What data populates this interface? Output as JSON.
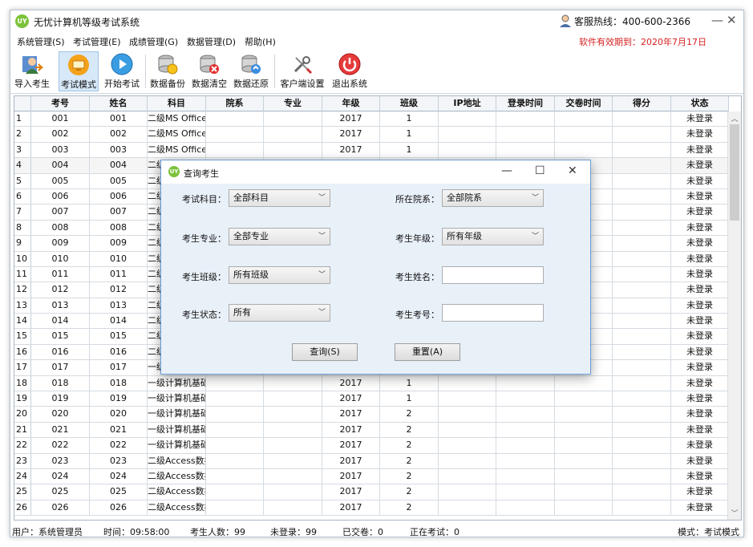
{
  "app": {
    "title": "无忧计算机等级考试系统",
    "logo": "UY",
    "hotline": "客服热线：400-600-2366",
    "expire": "软件有效期到：2020年7月17日"
  },
  "menu": [
    "系统管理(S)",
    "考试管理(E)",
    "成绩管理(G)",
    "数据管理(D)",
    "帮助(H)"
  ],
  "toolbar": [
    {
      "label": "导入考生",
      "icon": "import-student-icon"
    },
    {
      "label": "考试模式",
      "icon": "exam-mode-icon"
    },
    {
      "label": "开始考试",
      "icon": "play-icon"
    },
    {
      "label": "数据备份",
      "icon": "database-backup-icon"
    },
    {
      "label": "数据清空",
      "icon": "database-clear-icon"
    },
    {
      "label": "数据还原",
      "icon": "database-restore-icon"
    },
    {
      "label": "客户端设置",
      "icon": "tools-icon"
    },
    {
      "label": "退出系统",
      "icon": "power-icon"
    }
  ],
  "table": {
    "columns": [
      "考号",
      "姓名",
      "科目",
      "院系",
      "专业",
      "年级",
      "班级",
      "IP地址",
      "登录时间",
      "交卷时间",
      "得分",
      "状态"
    ],
    "rows": [
      [
        "1",
        "001",
        "001",
        "二级MS Office",
        "",
        "",
        "2017",
        "1",
        "",
        "",
        "",
        "",
        "未登录"
      ],
      [
        "2",
        "002",
        "002",
        "二级MS Office",
        "",
        "",
        "2017",
        "1",
        "",
        "",
        "",
        "",
        "未登录"
      ],
      [
        "3",
        "003",
        "003",
        "二级MS Office",
        "",
        "",
        "2017",
        "1",
        "",
        "",
        "",
        "",
        "未登录"
      ],
      [
        "4",
        "004",
        "004",
        "二级",
        "",
        "",
        "",
        "",
        "",
        "",
        "",
        "",
        "未登录"
      ],
      [
        "5",
        "005",
        "005",
        "二级",
        "",
        "",
        "",
        "",
        "",
        "",
        "",
        "",
        "未登录"
      ],
      [
        "6",
        "006",
        "006",
        "二级",
        "",
        "",
        "",
        "",
        "",
        "",
        "",
        "",
        "未登录"
      ],
      [
        "7",
        "007",
        "007",
        "二级",
        "",
        "",
        "",
        "",
        "",
        "",
        "",
        "",
        "未登录"
      ],
      [
        "8",
        "008",
        "008",
        "二级",
        "",
        "",
        "",
        "",
        "",
        "",
        "",
        "",
        "未登录"
      ],
      [
        "9",
        "009",
        "009",
        "二级",
        "",
        "",
        "",
        "",
        "",
        "",
        "",
        "",
        "未登录"
      ],
      [
        "10",
        "010",
        "010",
        "二级",
        "",
        "",
        "",
        "",
        "",
        "",
        "",
        "",
        "未登录"
      ],
      [
        "11",
        "011",
        "011",
        "二级",
        "",
        "",
        "",
        "",
        "",
        "",
        "",
        "",
        "未登录"
      ],
      [
        "12",
        "012",
        "012",
        "二级",
        "",
        "",
        "",
        "",
        "",
        "",
        "",
        "",
        "未登录"
      ],
      [
        "13",
        "013",
        "013",
        "二级",
        "",
        "",
        "",
        "",
        "",
        "",
        "",
        "",
        "未登录"
      ],
      [
        "14",
        "014",
        "014",
        "二级",
        "",
        "",
        "",
        "",
        "",
        "",
        "",
        "",
        "未登录"
      ],
      [
        "15",
        "015",
        "015",
        "二级",
        "",
        "",
        "",
        "",
        "",
        "",
        "",
        "",
        "未登录"
      ],
      [
        "16",
        "016",
        "016",
        "二级",
        "",
        "",
        "",
        "",
        "",
        "",
        "",
        "",
        "未登录"
      ],
      [
        "17",
        "017",
        "017",
        "一级",
        "",
        "",
        "",
        "",
        "",
        "",
        "",
        "",
        "未登录"
      ],
      [
        "18",
        "018",
        "018",
        "一级计算机基础",
        "",
        "",
        "2017",
        "1",
        "",
        "",
        "",
        "",
        "未登录"
      ],
      [
        "19",
        "019",
        "019",
        "一级计算机基础",
        "",
        "",
        "2017",
        "1",
        "",
        "",
        "",
        "",
        "未登录"
      ],
      [
        "20",
        "020",
        "020",
        "一级计算机基础",
        "",
        "",
        "2017",
        "2",
        "",
        "",
        "",
        "",
        "未登录"
      ],
      [
        "21",
        "021",
        "021",
        "一级计算机基础",
        "",
        "",
        "2017",
        "2",
        "",
        "",
        "",
        "",
        "未登录"
      ],
      [
        "22",
        "022",
        "022",
        "一级计算机基础",
        "",
        "",
        "2017",
        "2",
        "",
        "",
        "",
        "",
        "未登录"
      ],
      [
        "23",
        "023",
        "023",
        "二级Access数据库",
        "",
        "",
        "2017",
        "2",
        "",
        "",
        "",
        "",
        "未登录"
      ],
      [
        "24",
        "024",
        "024",
        "二级Access数据库",
        "",
        "",
        "2017",
        "2",
        "",
        "",
        "",
        "",
        "未登录"
      ],
      [
        "25",
        "025",
        "025",
        "二级Access数据库",
        "",
        "",
        "2017",
        "2",
        "",
        "",
        "",
        "",
        "未登录"
      ],
      [
        "26",
        "026",
        "026",
        "二级Access数据库",
        "",
        "",
        "2017",
        "2",
        "",
        "",
        "",
        "",
        "未登录"
      ]
    ]
  },
  "status": {
    "user": "用户：系统管理员",
    "time": "时间：09:58:00",
    "total": "考生人数：99",
    "not_logged": "未登录：99",
    "submitted": "已交卷：0",
    "in_exam": "正在考试：0",
    "mode": "模式：考试模式"
  },
  "dialog": {
    "title": "查询考生",
    "fields": {
      "subject": {
        "label": "考试科目：",
        "value": "全部科目"
      },
      "department": {
        "label": "所在院系：",
        "value": "全部院系"
      },
      "major": {
        "label": "考生专业：",
        "value": "全部专业"
      },
      "grade": {
        "label": "考生年级：",
        "value": "所有年级"
      },
      "class": {
        "label": "考生班级：",
        "value": "所有班级"
      },
      "name": {
        "label": "考生姓名：",
        "value": ""
      },
      "state": {
        "label": "考生状态：",
        "value": "所有"
      },
      "id": {
        "label": "考生考号：",
        "value": ""
      }
    },
    "query_label": "查询(S)",
    "reset_label": "重置(A)"
  }
}
